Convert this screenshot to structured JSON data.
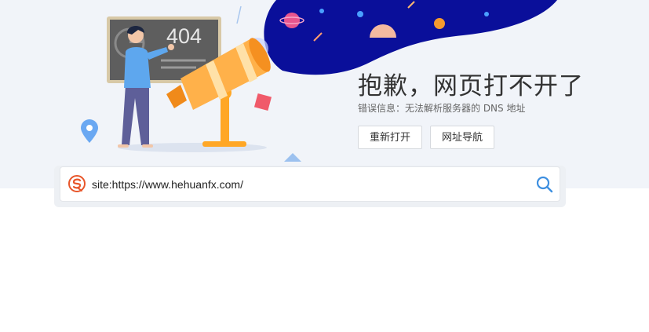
{
  "error_page": {
    "board_text": "404",
    "title": "抱歉，网页打不开了",
    "error_message": "错误信息：无法解析服务器的 DNS 地址",
    "buttons": {
      "reopen": "重新打开",
      "url_navigation": "网址导航"
    }
  },
  "search": {
    "value": "site:https://www.hehuanfx.com/",
    "logo_icon": "sogou-logo-icon",
    "search_icon": "magnifier-icon"
  },
  "colors": {
    "hero_background": "#f1f4f9",
    "galaxy": "#0a0f9a",
    "telescope": "#ffa726",
    "search_icon": "#3d8fe0",
    "logo": "#e8562a"
  }
}
